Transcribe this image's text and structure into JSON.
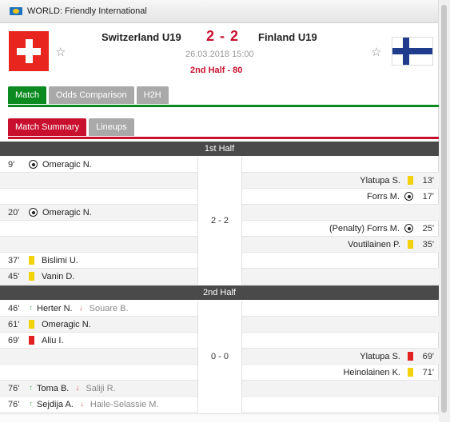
{
  "league": "WORLD: Friendly International",
  "match": {
    "home": "Switzerland U19",
    "away": "Finland U19",
    "score": "2 - 2",
    "datetime": "26.03.2018 15:00",
    "status": "2nd Half - 80"
  },
  "tabs_main": [
    "Match",
    "Odds Comparison",
    "H2H"
  ],
  "tabs_sub": [
    "Match Summary",
    "Lineups"
  ],
  "first_half": {
    "label": "1st Half",
    "score": "2 - 2",
    "events": [
      {
        "side": "home",
        "minute": "9'",
        "type": "goal",
        "player": "Omeragic N."
      },
      {
        "side": "away",
        "minute": "13'",
        "type": "yellow",
        "player": "Ylatupa S."
      },
      {
        "side": "away",
        "minute": "17'",
        "type": "goal",
        "player": "Forrs M."
      },
      {
        "side": "home",
        "minute": "20'",
        "type": "goal",
        "player": "Omeragic N."
      },
      {
        "side": "away",
        "minute": "25'",
        "type": "goal",
        "player": "(Penalty) Forrs M."
      },
      {
        "side": "away",
        "minute": "35'",
        "type": "yellow",
        "player": "Voutilainen P."
      },
      {
        "side": "home",
        "minute": "37'",
        "type": "yellow",
        "player": "Bislimi U."
      },
      {
        "side": "home",
        "minute": "45'",
        "type": "yellow",
        "player": "Vanin D."
      }
    ]
  },
  "second_half": {
    "label": "2nd Half",
    "score": "0 - 0",
    "events": [
      {
        "side": "home",
        "minute": "46'",
        "type": "sub",
        "player": "Herter N.",
        "out": "Souare B."
      },
      {
        "side": "home",
        "minute": "61'",
        "type": "yellow",
        "player": "Omeragic N."
      },
      {
        "side": "home",
        "minute": "69'",
        "type": "red",
        "player": "Aliu I."
      },
      {
        "side": "away",
        "minute": "69'",
        "type": "red",
        "player": "Ylatupa S."
      },
      {
        "side": "away",
        "minute": "71'",
        "type": "yellow",
        "player": "Heinolainen K."
      },
      {
        "side": "home",
        "minute": "76'",
        "type": "sub",
        "player": "Toma B.",
        "out": "Saliji R."
      },
      {
        "side": "home",
        "minute": "76'",
        "type": "sub",
        "player": "Sejdija A.",
        "out": "Haile-Selassie M."
      }
    ]
  },
  "colors": {
    "accent_red": "#c8102e",
    "accent_green": "#0b8a1f",
    "period_bar": "#4a4a4a"
  }
}
